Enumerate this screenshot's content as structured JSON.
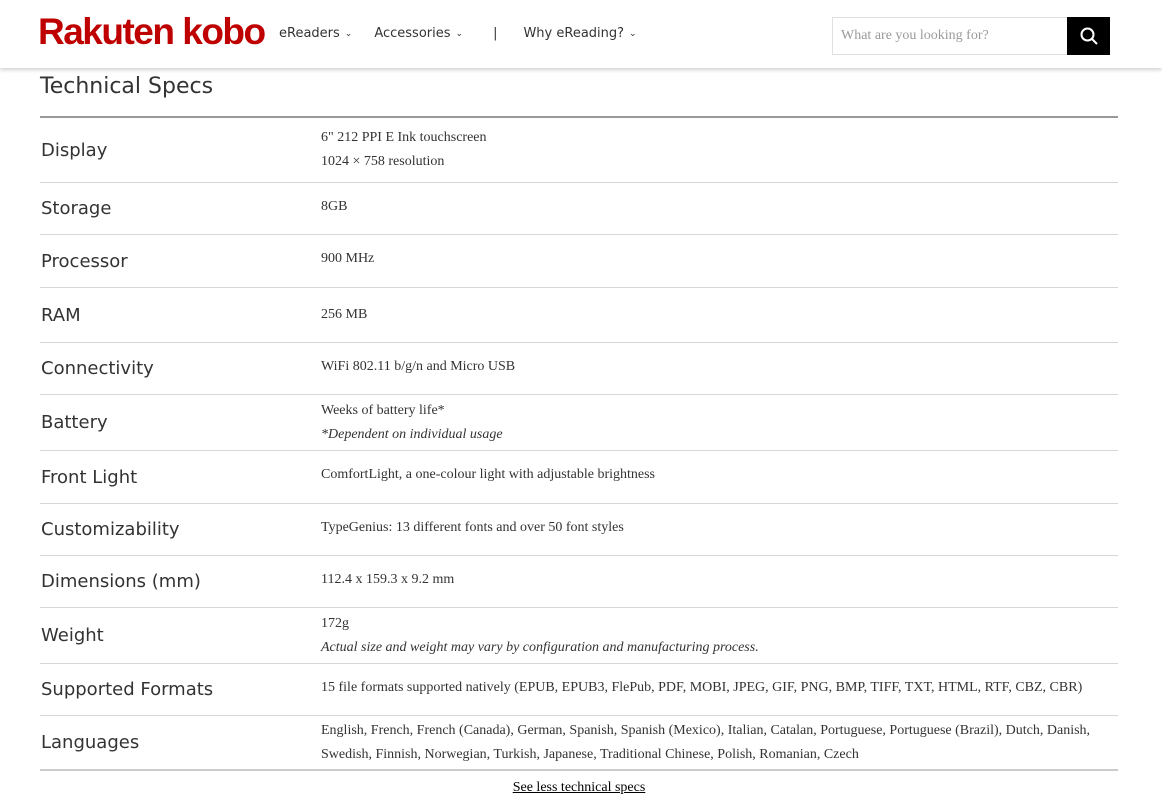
{
  "header": {
    "logo_text": "Rakuten kobo",
    "nav": [
      {
        "label": "eReaders"
      },
      {
        "label": "Accessories"
      },
      {
        "label": "Why eReading?"
      }
    ],
    "search_placeholder": "What are you looking for?"
  },
  "specs": {
    "title": "Technical Specs",
    "rows": [
      {
        "label": "Display",
        "lines": [
          "6\" 212 PPI E Ink touchscreen",
          "1024 × 758 resolution"
        ]
      },
      {
        "label": "Storage",
        "value": "8GB"
      },
      {
        "label": "Processor",
        "value": "900 MHz"
      },
      {
        "label": "RAM",
        "value": "256 MB"
      },
      {
        "label": "Connectivity",
        "value": "WiFi 802.11 b/g/n and Micro USB"
      },
      {
        "label": "Battery",
        "value": "Weeks of battery life*",
        "note": "*Dependent on individual usage"
      },
      {
        "label": "Front Light",
        "value": "ComfortLight, a one-colour light with adjustable brightness"
      },
      {
        "label": "Customizability",
        "value": "TypeGenius: 13 different fonts and over 50 font styles"
      },
      {
        "label": "Dimensions (mm)",
        "value": "112.4 x 159.3 x 9.2 mm"
      },
      {
        "label": "Weight",
        "value": "172g",
        "note": "Actual size and weight may vary by configuration and manufacturing process."
      },
      {
        "label": "Supported Formats",
        "value": "15 file formats supported natively (EPUB, EPUB3, FlePub, PDF, MOBI, JPEG, GIF, PNG, BMP, TIFF, TXT, HTML, RTF, CBZ, CBR)"
      },
      {
        "label": "Languages",
        "value": "English, French, French (Canada), German, Spanish, Spanish (Mexico), Italian, Catalan, Portuguese, Portuguese (Brazil), Dutch, Danish, Swedish, Finnish, Norwegian, Turkish, Japanese, Traditional Chinese, Polish, Romanian, Czech"
      }
    ],
    "toggle_label": "See less technical specs"
  },
  "colors": {
    "brand": "#bf0000",
    "search_button": "#000000"
  }
}
